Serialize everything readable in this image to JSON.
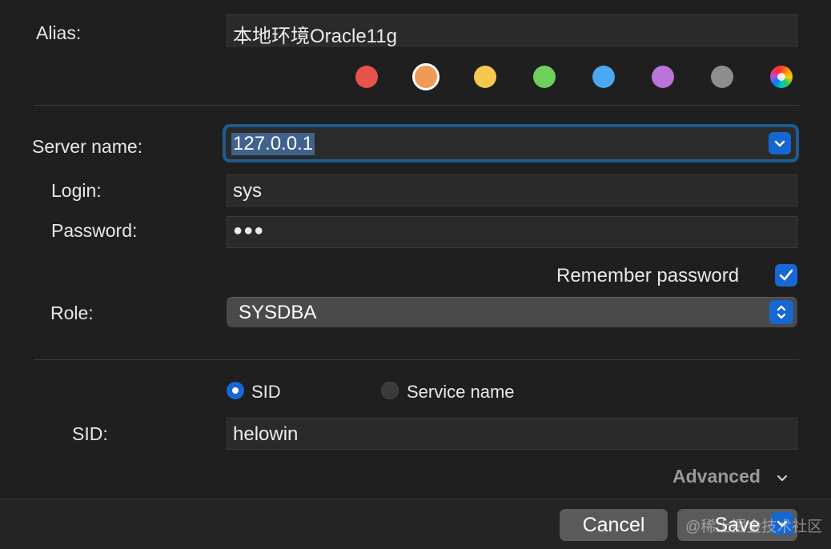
{
  "alias": {
    "label": "Alias:",
    "value": "本地环境Oracle11g"
  },
  "colors": [
    {
      "name": "red",
      "hex": "#e5534b",
      "selected": false
    },
    {
      "name": "orange",
      "hex": "#f19a55",
      "selected": true
    },
    {
      "name": "yellow",
      "hex": "#f5c94d",
      "selected": false
    },
    {
      "name": "green",
      "hex": "#6fcf5b",
      "selected": false
    },
    {
      "name": "blue",
      "hex": "#4ba8f0",
      "selected": false
    },
    {
      "name": "purple",
      "hex": "#b974d8",
      "selected": false
    },
    {
      "name": "gray",
      "hex": "#8e8e8e",
      "selected": false
    },
    {
      "name": "custom",
      "hex": "multicolor",
      "selected": false
    }
  ],
  "server": {
    "label": "Server name:",
    "value": "127.0.0.1"
  },
  "login": {
    "label": "Login:",
    "value": "sys"
  },
  "password": {
    "label": "Password:",
    "value": "●●●"
  },
  "remember": {
    "label": "Remember password",
    "checked": true
  },
  "role": {
    "label": "Role:",
    "value": "SYSDBA"
  },
  "connection_type": {
    "sid_option": "SID",
    "service_option": "Service name",
    "selected": "SID"
  },
  "sid": {
    "label": "SID:",
    "value": "helowin"
  },
  "advanced": {
    "label": "Advanced"
  },
  "footer": {
    "cancel_label": "Cancel",
    "save_label": "Save"
  },
  "watermark": "@稀土掘金技术社区"
}
